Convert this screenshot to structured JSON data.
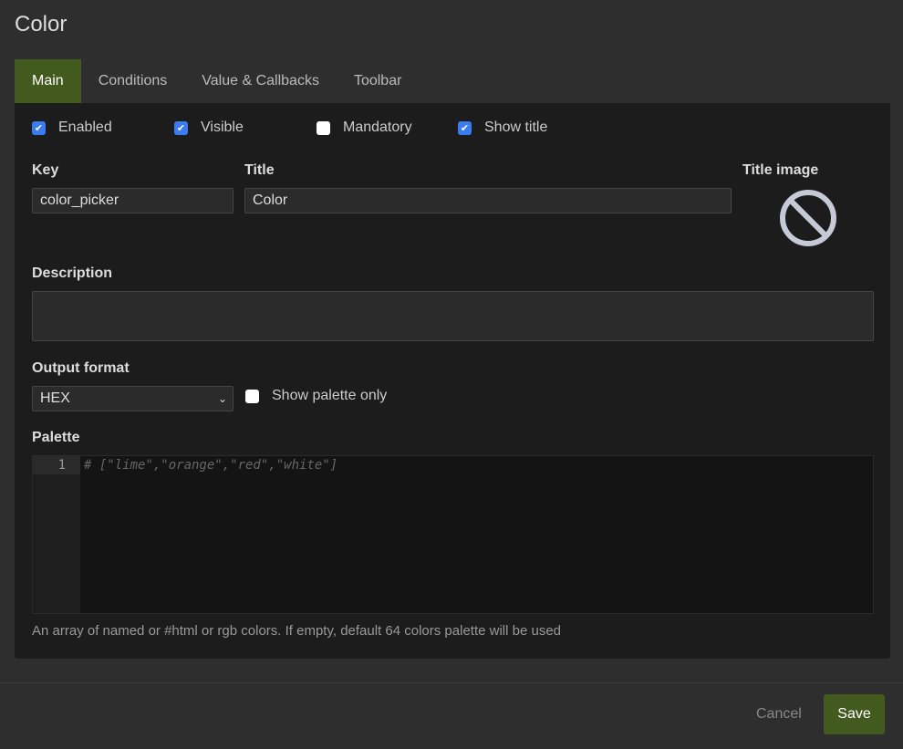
{
  "dialog": {
    "title": "Color"
  },
  "tabs": [
    {
      "label": "Main"
    },
    {
      "label": "Conditions"
    },
    {
      "label": "Value & Callbacks"
    },
    {
      "label": "Toolbar"
    }
  ],
  "checkboxes": {
    "enabled": {
      "label": "Enabled",
      "checked": true
    },
    "visible": {
      "label": "Visible",
      "checked": true
    },
    "mandatory": {
      "label": "Mandatory",
      "checked": false
    },
    "show_title": {
      "label": "Show title",
      "checked": true
    },
    "palette_only": {
      "label": "Show palette only",
      "checked": false
    }
  },
  "fields": {
    "key_label": "Key",
    "key_value": "color_picker",
    "title_label": "Title",
    "title_value": "Color",
    "title_image_label": "Title image",
    "description_label": "Description",
    "description_value": "",
    "output_label": "Output format",
    "output_value": "HEX",
    "palette_label": "Palette",
    "palette_line": "1",
    "palette_placeholder": "# [\"lime\",\"orange\",\"red\",\"white\"]",
    "palette_help": "An array of named or #html or rgb colors. If empty, default 64 colors palette will be used"
  },
  "footer": {
    "cancel": "Cancel",
    "save": "Save"
  }
}
